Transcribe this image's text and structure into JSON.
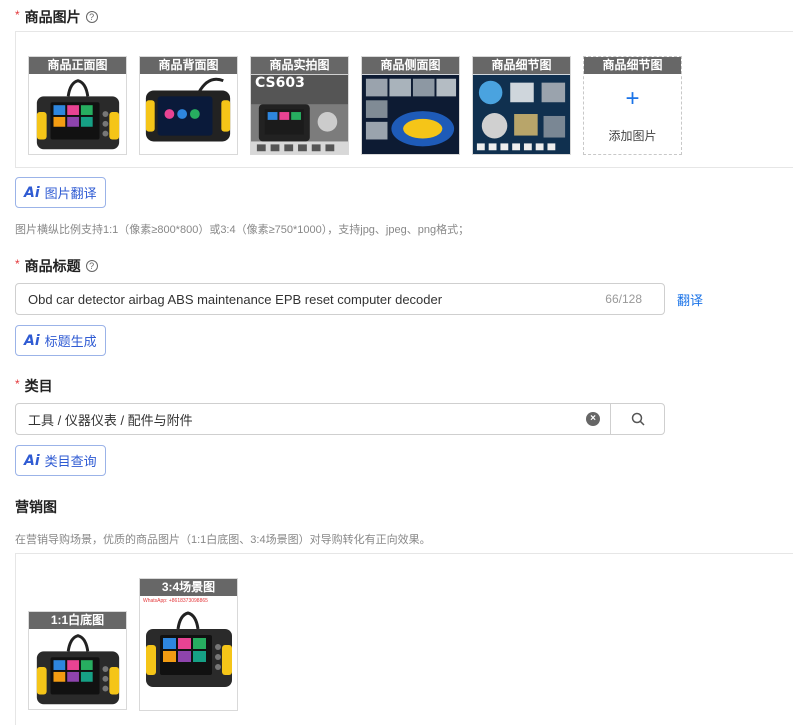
{
  "product_images": {
    "required_mark": "*",
    "label": "商品图片",
    "help_icon": "question-circle-icon",
    "thumbnails": [
      {
        "caption": "商品正面图"
      },
      {
        "caption": "商品背面图"
      },
      {
        "caption": "商品实拍图",
        "overlay_text": "CS603"
      },
      {
        "caption": "商品侧面图"
      },
      {
        "caption": "商品细节图"
      }
    ],
    "add_slot": {
      "caption": "商品细节图",
      "plus": "+",
      "text": "添加图片"
    },
    "ai_button": {
      "icon": "Ai",
      "label": "图片翻译"
    },
    "hint": "图片横纵比例支持1:1（像素≥800*800）或3:4（像素≥750*1000），支持jpg、jpeg、png格式；"
  },
  "product_title": {
    "required_mark": "*",
    "label": "商品标题",
    "help_icon": "question-circle-icon",
    "value": "Obd car detector airbag ABS maintenance EPB reset computer decoder",
    "counter": "66/128",
    "translate_link": "翻译",
    "ai_button": {
      "icon": "Ai",
      "label": "标题生成"
    }
  },
  "category": {
    "required_mark": "*",
    "label": "类目",
    "value": "工具 / 仪器仪表 / 配件与附件",
    "clear_icon": "clear-circle-icon",
    "search_icon": "search-icon",
    "ai_button": {
      "icon": "Ai",
      "label": "类目查询"
    }
  },
  "marketing": {
    "label": "营销图",
    "hint": "在营销导购场景，优质的商品图片（1:1白底图、3:4场景图）对导购转化有正向效果。",
    "thumbnails": [
      {
        "caption": "1:1白底图"
      },
      {
        "caption": "3:4场景图",
        "watermark": "WhatsApp: +8618373098865"
      }
    ]
  },
  "colors": {
    "accent": "#1a73e8",
    "required": "#e4393c",
    "ai_text": "#2f5bd3",
    "device_yellow": "#f5c518"
  }
}
